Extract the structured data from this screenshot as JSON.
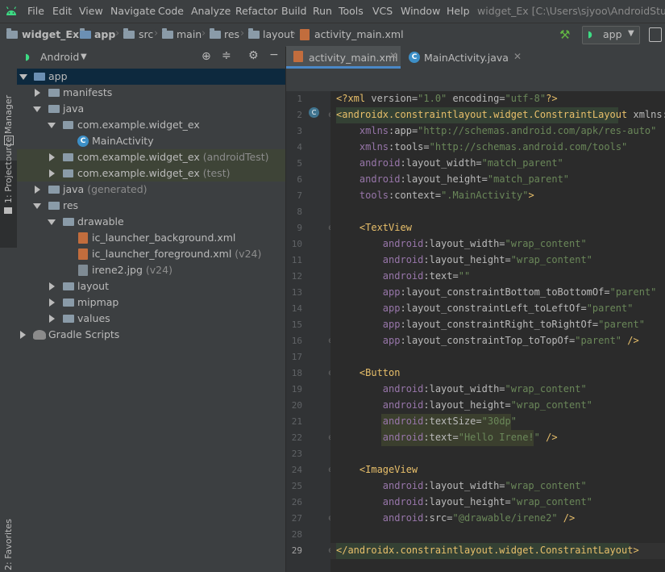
{
  "menu": {
    "items": [
      "File",
      "Edit",
      "View",
      "Navigate",
      "Code",
      "Analyze",
      "Refactor",
      "Build",
      "Run",
      "Tools",
      "VCS",
      "Window",
      "Help"
    ],
    "window_title": "widget_Ex [C:\\Users\\sjyoo\\AndroidStudio"
  },
  "nav": {
    "crumbs": [
      "widget_Ex",
      "app",
      "src",
      "main",
      "res",
      "layout",
      "activity_main.xml"
    ],
    "run_config": "app"
  },
  "stripe": {
    "resource_manager": "Resource Manager",
    "project": "1: Project",
    "favorites": "2: Favorites"
  },
  "project": {
    "view_label": "Android",
    "tree": [
      {
        "label": "app",
        "hint": ""
      },
      {
        "label": "manifests",
        "hint": ""
      },
      {
        "label": "java",
        "hint": ""
      },
      {
        "label": "com.example.widget_ex",
        "hint": ""
      },
      {
        "label": "MainActivity",
        "hint": ""
      },
      {
        "label": "com.example.widget_ex",
        "hint": "(androidTest)"
      },
      {
        "label": "com.example.widget_ex",
        "hint": "(test)"
      },
      {
        "label": "java",
        "hint": "(generated)"
      },
      {
        "label": "res",
        "hint": ""
      },
      {
        "label": "drawable",
        "hint": ""
      },
      {
        "label": "ic_launcher_background.xml",
        "hint": ""
      },
      {
        "label": "ic_launcher_foreground.xml",
        "hint": "(v24)"
      },
      {
        "label": "irene2.jpg",
        "hint": "(v24)"
      },
      {
        "label": "layout",
        "hint": ""
      },
      {
        "label": "mipmap",
        "hint": ""
      },
      {
        "label": "values",
        "hint": ""
      },
      {
        "label": "Gradle Scripts",
        "hint": ""
      }
    ]
  },
  "tabs": [
    {
      "label": "activity_main.xml",
      "active": true
    },
    {
      "label": "MainActivity.java",
      "active": false
    }
  ],
  "code": {
    "line_numbers": [
      "1",
      "2",
      "3",
      "4",
      "5",
      "6",
      "7",
      "8",
      "9",
      "10",
      "11",
      "12",
      "13",
      "14",
      "15",
      "16",
      "17",
      "18",
      "19",
      "20",
      "21",
      "22",
      "23",
      "24",
      "25",
      "26",
      "27",
      "28",
      "29"
    ],
    "gutter_badge": "C",
    "lines": [
      "<?xml version=\"1.0\" encoding=\"utf-8\"?>",
      "<androidx.constraintlayout.widget.ConstraintLayout xmlns:an",
      "    xmlns:app=\"http://schemas.android.com/apk/res-auto\"",
      "    xmlns:tools=\"http://schemas.android.com/tools\"",
      "    android:layout_width=\"match_parent\"",
      "    android:layout_height=\"match_parent\"",
      "    tools:context=\".MainActivity\">",
      "",
      "    <TextView",
      "        android:layout_width=\"wrap_content\"",
      "        android:layout_height=\"wrap_content\"",
      "        android:text=\"\"",
      "        app:layout_constraintBottom_toBottomOf=\"parent\"",
      "        app:layout_constraintLeft_toLeftOf=\"parent\"",
      "        app:layout_constraintRight_toRightOf=\"parent\"",
      "        app:layout_constraintTop_toTopOf=\"parent\" />",
      "",
      "    <Button",
      "        android:layout_width=\"wrap_content\"",
      "        android:layout_height=\"wrap_content\"",
      "        android:textSize=\"30dp\"",
      "        android:text=\"Hello Irene!\" />",
      "",
      "    <ImageView",
      "        android:layout_width=\"wrap_content\"",
      "        android:layout_height=\"wrap_content\"",
      "        android:src=\"@drawable/irene2\" />",
      "",
      "</androidx.constraintlayout.widget.ConstraintLayout>"
    ]
  },
  "colors": {
    "tag": "#e8bf6a",
    "attribute": "#bababa",
    "namespace": "#9876aa",
    "string": "#6a8759",
    "selection": "#0d293e"
  }
}
